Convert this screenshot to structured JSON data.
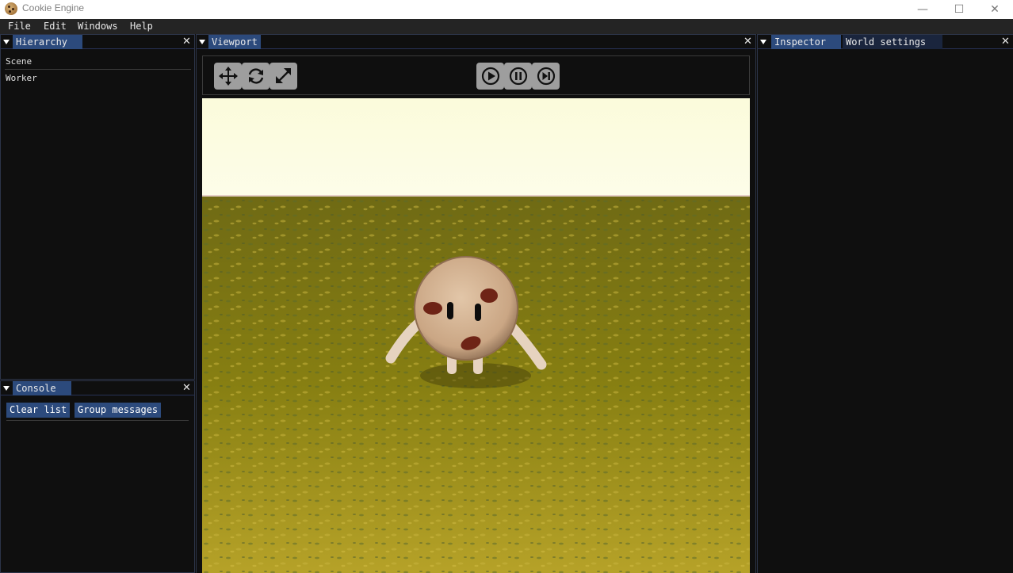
{
  "window": {
    "title": "Cookie Engine",
    "controls": {
      "minimize": "—",
      "maximize": "☐",
      "close": "✕"
    }
  },
  "menu": {
    "items": [
      {
        "label": "File"
      },
      {
        "label": "Edit"
      },
      {
        "label": "Windows"
      },
      {
        "label": "Help"
      }
    ]
  },
  "hierarchy": {
    "title": "Hierarchy",
    "items": [
      {
        "label": "Scene"
      },
      {
        "label": "Worker"
      }
    ]
  },
  "console": {
    "title": "Console",
    "clear_label": "Clear list",
    "group_label": "Group messages"
  },
  "viewport": {
    "title": "Viewport",
    "tools": {
      "move": "move-icon",
      "rotate": "rotate-icon",
      "scale": "scale-icon"
    },
    "playback": {
      "play": "play-icon",
      "pause": "pause-icon",
      "step": "step-icon"
    },
    "colors": {
      "sky": "#fbfcdc",
      "ground": "#7f7a12",
      "cookie": "#d7b898",
      "chip": "#6e2416"
    }
  },
  "inspector": {
    "tabs": [
      {
        "label": "Inspector"
      },
      {
        "label": "World settings"
      }
    ]
  },
  "colors": {
    "accent": "#2c4a7c",
    "panel_bg": "#0f0f0f",
    "menubar_bg": "#242424"
  }
}
